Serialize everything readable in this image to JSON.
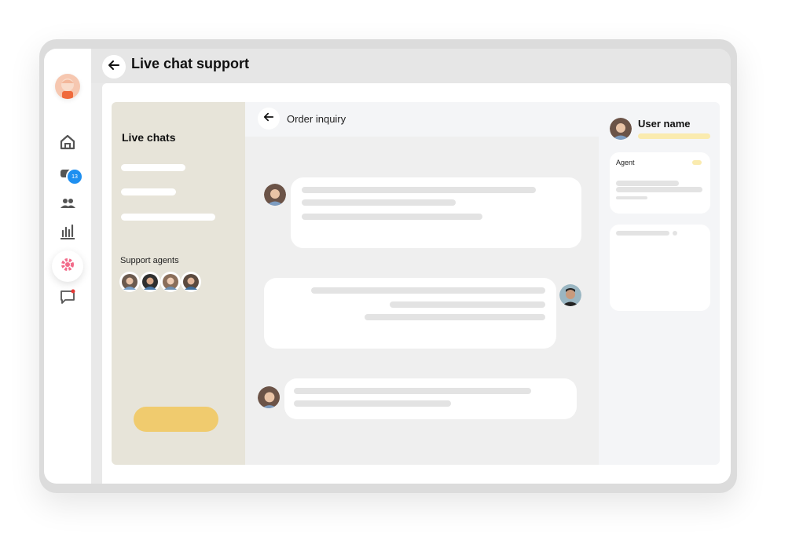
{
  "header": {
    "title": "Live chat support"
  },
  "sidebar": {
    "badge_count": "13",
    "items": [
      {
        "icon": "home-icon"
      },
      {
        "icon": "ticket-icon"
      },
      {
        "icon": "users-icon"
      },
      {
        "icon": "chart-icon"
      },
      {
        "icon": "gear-icon",
        "active": true
      },
      {
        "icon": "chat-icon"
      }
    ]
  },
  "chat_list": {
    "title": "Live chats",
    "support_agents_label": "Support agents"
  },
  "conversation": {
    "title": "Order inquiry"
  },
  "details": {
    "user_name": "User name",
    "agent_label": "Agent"
  },
  "colors": {
    "accent_yellow": "#f0cb6e",
    "badge_blue": "#1e8ff0",
    "gear_pink": "#f26b8a",
    "chat_list_bg": "#e7e4d9"
  }
}
